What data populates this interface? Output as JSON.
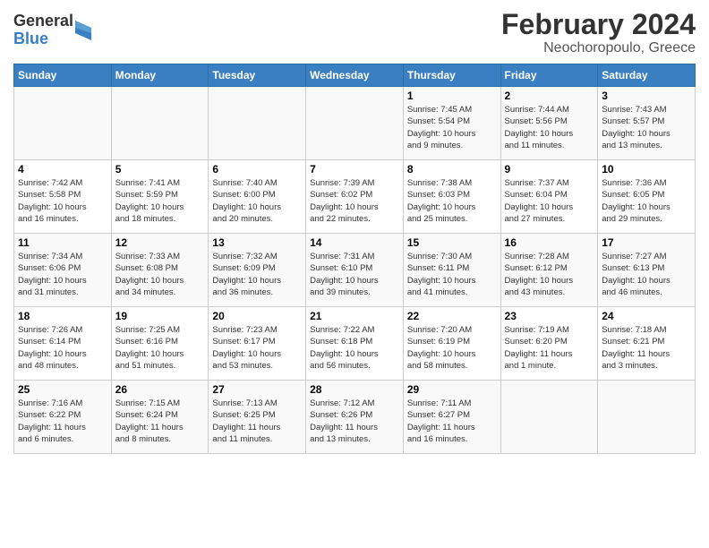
{
  "header": {
    "logo_general": "General",
    "logo_blue": "Blue",
    "title": "February 2024",
    "subtitle": "Neochoropoulo, Greece"
  },
  "days_of_week": [
    "Sunday",
    "Monday",
    "Tuesday",
    "Wednesday",
    "Thursday",
    "Friday",
    "Saturday"
  ],
  "weeks": [
    [
      {
        "day": "",
        "info": ""
      },
      {
        "day": "",
        "info": ""
      },
      {
        "day": "",
        "info": ""
      },
      {
        "day": "",
        "info": ""
      },
      {
        "day": "1",
        "info": "Sunrise: 7:45 AM\nSunset: 5:54 PM\nDaylight: 10 hours\nand 9 minutes."
      },
      {
        "day": "2",
        "info": "Sunrise: 7:44 AM\nSunset: 5:56 PM\nDaylight: 10 hours\nand 11 minutes."
      },
      {
        "day": "3",
        "info": "Sunrise: 7:43 AM\nSunset: 5:57 PM\nDaylight: 10 hours\nand 13 minutes."
      }
    ],
    [
      {
        "day": "4",
        "info": "Sunrise: 7:42 AM\nSunset: 5:58 PM\nDaylight: 10 hours\nand 16 minutes."
      },
      {
        "day": "5",
        "info": "Sunrise: 7:41 AM\nSunset: 5:59 PM\nDaylight: 10 hours\nand 18 minutes."
      },
      {
        "day": "6",
        "info": "Sunrise: 7:40 AM\nSunset: 6:00 PM\nDaylight: 10 hours\nand 20 minutes."
      },
      {
        "day": "7",
        "info": "Sunrise: 7:39 AM\nSunset: 6:02 PM\nDaylight: 10 hours\nand 22 minutes."
      },
      {
        "day": "8",
        "info": "Sunrise: 7:38 AM\nSunset: 6:03 PM\nDaylight: 10 hours\nand 25 minutes."
      },
      {
        "day": "9",
        "info": "Sunrise: 7:37 AM\nSunset: 6:04 PM\nDaylight: 10 hours\nand 27 minutes."
      },
      {
        "day": "10",
        "info": "Sunrise: 7:36 AM\nSunset: 6:05 PM\nDaylight: 10 hours\nand 29 minutes."
      }
    ],
    [
      {
        "day": "11",
        "info": "Sunrise: 7:34 AM\nSunset: 6:06 PM\nDaylight: 10 hours\nand 31 minutes."
      },
      {
        "day": "12",
        "info": "Sunrise: 7:33 AM\nSunset: 6:08 PM\nDaylight: 10 hours\nand 34 minutes."
      },
      {
        "day": "13",
        "info": "Sunrise: 7:32 AM\nSunset: 6:09 PM\nDaylight: 10 hours\nand 36 minutes."
      },
      {
        "day": "14",
        "info": "Sunrise: 7:31 AM\nSunset: 6:10 PM\nDaylight: 10 hours\nand 39 minutes."
      },
      {
        "day": "15",
        "info": "Sunrise: 7:30 AM\nSunset: 6:11 PM\nDaylight: 10 hours\nand 41 minutes."
      },
      {
        "day": "16",
        "info": "Sunrise: 7:28 AM\nSunset: 6:12 PM\nDaylight: 10 hours\nand 43 minutes."
      },
      {
        "day": "17",
        "info": "Sunrise: 7:27 AM\nSunset: 6:13 PM\nDaylight: 10 hours\nand 46 minutes."
      }
    ],
    [
      {
        "day": "18",
        "info": "Sunrise: 7:26 AM\nSunset: 6:14 PM\nDaylight: 10 hours\nand 48 minutes."
      },
      {
        "day": "19",
        "info": "Sunrise: 7:25 AM\nSunset: 6:16 PM\nDaylight: 10 hours\nand 51 minutes."
      },
      {
        "day": "20",
        "info": "Sunrise: 7:23 AM\nSunset: 6:17 PM\nDaylight: 10 hours\nand 53 minutes."
      },
      {
        "day": "21",
        "info": "Sunrise: 7:22 AM\nSunset: 6:18 PM\nDaylight: 10 hours\nand 56 minutes."
      },
      {
        "day": "22",
        "info": "Sunrise: 7:20 AM\nSunset: 6:19 PM\nDaylight: 10 hours\nand 58 minutes."
      },
      {
        "day": "23",
        "info": "Sunrise: 7:19 AM\nSunset: 6:20 PM\nDaylight: 11 hours\nand 1 minute."
      },
      {
        "day": "24",
        "info": "Sunrise: 7:18 AM\nSunset: 6:21 PM\nDaylight: 11 hours\nand 3 minutes."
      }
    ],
    [
      {
        "day": "25",
        "info": "Sunrise: 7:16 AM\nSunset: 6:22 PM\nDaylight: 11 hours\nand 6 minutes."
      },
      {
        "day": "26",
        "info": "Sunrise: 7:15 AM\nSunset: 6:24 PM\nDaylight: 11 hours\nand 8 minutes."
      },
      {
        "day": "27",
        "info": "Sunrise: 7:13 AM\nSunset: 6:25 PM\nDaylight: 11 hours\nand 11 minutes."
      },
      {
        "day": "28",
        "info": "Sunrise: 7:12 AM\nSunset: 6:26 PM\nDaylight: 11 hours\nand 13 minutes."
      },
      {
        "day": "29",
        "info": "Sunrise: 7:11 AM\nSunset: 6:27 PM\nDaylight: 11 hours\nand 16 minutes."
      },
      {
        "day": "",
        "info": ""
      },
      {
        "day": "",
        "info": ""
      }
    ]
  ]
}
